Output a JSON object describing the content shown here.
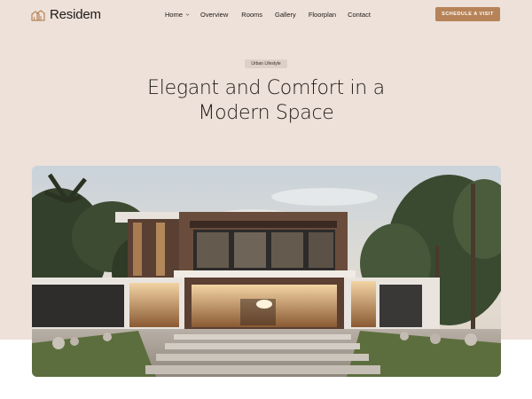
{
  "brand": {
    "name": "Residem",
    "logo_icon": "house-outline-icon"
  },
  "nav": {
    "items": [
      {
        "label": "Home",
        "has_dropdown": true
      },
      {
        "label": "Overview"
      },
      {
        "label": "Rooms"
      },
      {
        "label": "Gallery"
      },
      {
        "label": "Floorplan"
      },
      {
        "label": "Contact"
      }
    ],
    "dropdown_icon": "chevron-down-icon"
  },
  "cta": {
    "label": "SCHEDULE A VISIT"
  },
  "hero": {
    "tag": "Urban Lifestyle",
    "title_line1": "Elegant and Comfort in a",
    "title_line2": "Modern Space",
    "image": "modern-house-photo"
  },
  "colors": {
    "hero_background": "#ede1d9",
    "accent": "#b68358",
    "tag_background": "#dcd0c7",
    "text": "#1f1a17"
  }
}
